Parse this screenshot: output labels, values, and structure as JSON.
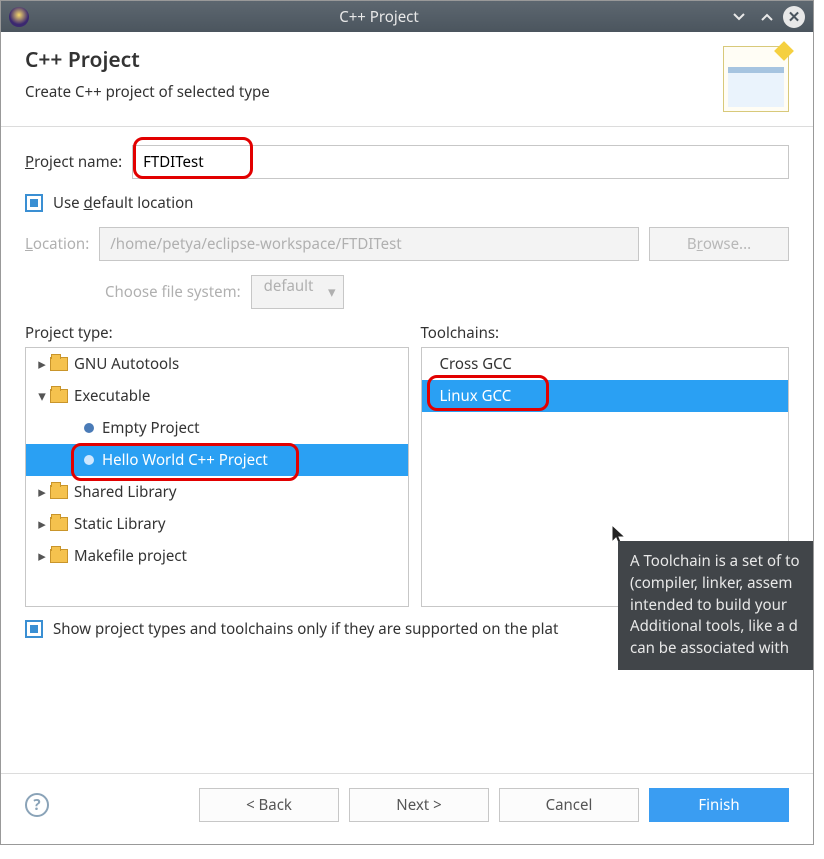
{
  "titlebar": {
    "title": "C++ Project"
  },
  "header": {
    "title": "C++ Project",
    "subtitle": "Create C++ project of selected type"
  },
  "form": {
    "project_name_label": "Project name:",
    "project_name_value": "FTDITest",
    "use_default_location_label": "Use default location",
    "location_label": "Location:",
    "location_value": "/home/petya/eclipse-workspace/FTDITest",
    "browse_label": "Browse...",
    "choose_fs_label": "Choose file system:",
    "fs_value": "default"
  },
  "project_type": {
    "label": "Project type:",
    "items": [
      {
        "text": "GNU Autotools",
        "expanded": false,
        "indent": 0,
        "icon": "folder"
      },
      {
        "text": "Executable",
        "expanded": true,
        "indent": 0,
        "icon": "folder"
      },
      {
        "text": "Empty Project",
        "indent": 2,
        "icon": "dot"
      },
      {
        "text": "Hello World C++ Project",
        "indent": 2,
        "icon": "dot",
        "selected": true
      },
      {
        "text": "Shared Library",
        "expanded": false,
        "indent": 0,
        "icon": "folder"
      },
      {
        "text": "Static Library",
        "expanded": false,
        "indent": 0,
        "icon": "folder"
      },
      {
        "text": "Makefile project",
        "expanded": false,
        "indent": 0,
        "icon": "folder"
      }
    ]
  },
  "toolchains": {
    "label": "Toolchains:",
    "items": [
      {
        "text": "Cross GCC"
      },
      {
        "text": "Linux GCC",
        "selected": true
      }
    ]
  },
  "filter_checkbox_label": "Show project types and toolchains only if they are supported on the plat",
  "tooltip": {
    "line1": "A Toolchain is a set of to",
    "line2": "(compiler, linker, assem",
    "line3": "intended to build your",
    "line4": "Additional tools, like a d",
    "line5": "can be associated with"
  },
  "buttons": {
    "back": "< Back",
    "next": "Next >",
    "cancel": "Cancel",
    "finish": "Finish"
  }
}
